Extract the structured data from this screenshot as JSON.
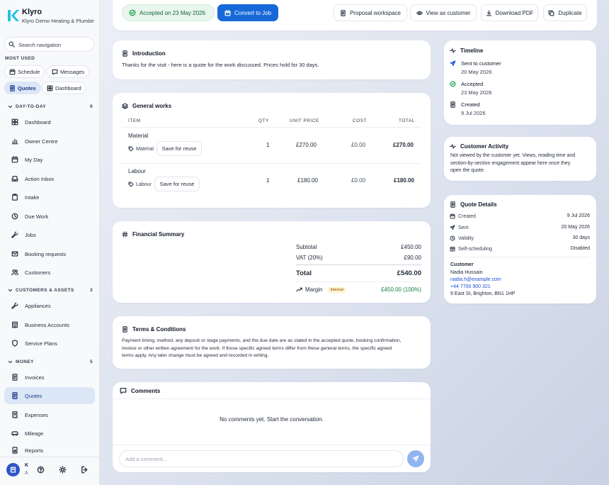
{
  "app": {
    "name": "Klyro",
    "company": "Klyro Demo Heating & Plumbing"
  },
  "search": {
    "placeholder": "Search navigation"
  },
  "sidebar": {
    "most_used_label": "MOST USED",
    "chips": [
      {
        "label": "Schedule",
        "icon": "calendar-icon"
      },
      {
        "label": "Messages",
        "icon": "message-icon"
      },
      {
        "label": "Quotes",
        "icon": "document-icon",
        "active": true
      },
      {
        "label": "Dashboard",
        "icon": "grid-icon"
      }
    ],
    "sections": [
      {
        "label": "DAY-TO-DAY",
        "count": "9",
        "items": [
          {
            "label": "Dashboard",
            "icon": "grid-icon"
          },
          {
            "label": "Owner Centre",
            "icon": "chart-icon"
          },
          {
            "label": "My Day",
            "icon": "calendar-icon"
          },
          {
            "label": "Action Inbox",
            "icon": "inbox-icon"
          },
          {
            "label": "Intake",
            "icon": "clipboard-icon"
          },
          {
            "label": "Due Work",
            "icon": "clock-icon"
          },
          {
            "label": "Jobs",
            "icon": "wrench-icon"
          },
          {
            "label": "Booking requests",
            "icon": "mail-icon"
          },
          {
            "label": "Customers",
            "icon": "users-icon"
          }
        ]
      },
      {
        "label": "CUSTOMERS & ASSETS",
        "count": "3",
        "items": [
          {
            "label": "Appliances",
            "icon": "wrench-icon"
          },
          {
            "label": "Business Accounts",
            "icon": "building-icon"
          },
          {
            "label": "Service Plans",
            "icon": "shield-icon"
          }
        ]
      },
      {
        "label": "MONEY",
        "count": "5",
        "items": [
          {
            "label": "Invoices",
            "icon": "invoice-icon"
          },
          {
            "label": "Quotes",
            "icon": "quote-icon",
            "active": true
          },
          {
            "label": "Expenses",
            "icon": "receipt-icon"
          },
          {
            "label": "Mileage",
            "icon": "car-icon"
          },
          {
            "label": "Reports",
            "icon": "report-icon"
          }
        ]
      }
    ],
    "user": {
      "initial": "K",
      "sub": "A"
    }
  },
  "toolbar": {
    "status": "Accepted on 23 May 2026",
    "convert": "Convert to Job",
    "proposal": "Proposal workspace",
    "view_customer": "View as customer",
    "download": "Download PDF",
    "duplicate": "Duplicate"
  },
  "intro": {
    "title": "Introduction",
    "text": "Thanks for the visit - here is a quote for the work discussed. Prices hold for 30 days."
  },
  "works": {
    "title": "General works",
    "headers": {
      "item": "ITEM",
      "qty": "QTY",
      "unit": "UNIT PRICE",
      "cost": "COST",
      "total": "TOTAL"
    },
    "rows": [
      {
        "name": "Material",
        "tag": "Material",
        "qty": "1",
        "unit": "£270.00",
        "cost": "£0.00",
        "total": "£270.00",
        "save": "Save for reuse"
      },
      {
        "name": "Labour",
        "tag": "Labour",
        "qty": "1",
        "unit": "£180.00",
        "cost": "£0.00",
        "total": "£180.00",
        "save": "Save for reuse"
      }
    ]
  },
  "financial": {
    "title": "Financial Summary",
    "subtotal_label": "Subtotal",
    "subtotal": "£450.00",
    "vat_label": "VAT (20%)",
    "vat": "£90.00",
    "total_label": "Total",
    "total": "£540.00",
    "margin_label": "Margin",
    "margin_badge": "Internal",
    "margin": "£450.00 (100%)"
  },
  "terms": {
    "title": "Terms & Conditions",
    "lines": [
      "Payment timing, method, any deposit or stage payments, and the due date are as stated in the accepted quote, booking confirmation,",
      "invoice or other written agreement for the work. If those specific agreed terms differ from these general terms, the specific agreed",
      "terms apply. Any later change must be agreed and recorded in writing."
    ]
  },
  "comments": {
    "title": "Comments",
    "empty": "No comments yet. Start the conversation.",
    "placeholder": "Add a comment..."
  },
  "timeline": {
    "title": "Timeline",
    "items": [
      {
        "label": "Sent to customer",
        "date": "20 May 2026",
        "icon": "send-icon"
      },
      {
        "label": "Accepted",
        "date": "23 May 2026",
        "icon": "check-circle-icon"
      },
      {
        "label": "Created",
        "date": "9 Jul 2026",
        "icon": "file-icon"
      }
    ]
  },
  "activity": {
    "title": "Customer Activity",
    "lines": [
      "Not viewed by the customer yet. Views, reading time and",
      "section-by-section engagement appear here once they",
      "open the quote."
    ]
  },
  "quote_details": {
    "title": "Quote Details",
    "rows": [
      {
        "label": "Created",
        "value": "9 Jul 2026",
        "icon": "calendar-icon"
      },
      {
        "label": "Sent",
        "value": "20 May 2026",
        "icon": "send-icon"
      },
      {
        "label": "Validity",
        "value": "30 days",
        "icon": "clock-icon"
      },
      {
        "label": "Self-scheduling",
        "value": "Disabled",
        "icon": "calendar-check-icon"
      }
    ],
    "customer_label": "Customer",
    "customer_name": "Nadia Hussain",
    "email": "nadia.h@example.com",
    "phone": "+44 7700 900 321",
    "address": "9 East St, Brighton, BN1 1HP"
  },
  "colors": {
    "accent": "#1769d8",
    "active_bg": "#dbe6f7",
    "success": "#16a34a",
    "margin_green": "#15803d"
  }
}
